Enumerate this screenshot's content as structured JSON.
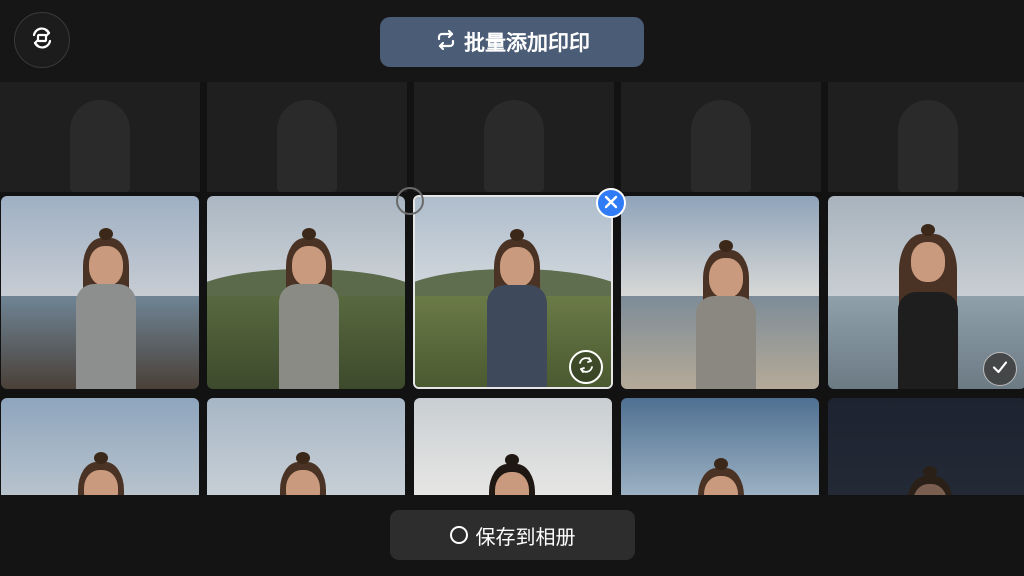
{
  "header": {
    "rotate_icon": "rotate-camera-icon",
    "batch_button_label": "批量添加印印",
    "batch_icon": "repeat-icon"
  },
  "gallery": {
    "selected_index": 2,
    "checked_index": 4,
    "rows": [
      [
        {
          "scene": "beach-sunset"
        },
        {
          "scene": "grassy-hills"
        },
        {
          "scene": "grassy-hills-selected"
        },
        {
          "scene": "beach-cloudy"
        },
        {
          "scene": "seaside-portrait"
        }
      ],
      [
        {
          "scene": "sky"
        },
        {
          "scene": "sky"
        },
        {
          "scene": "clouds"
        },
        {
          "scene": "blue-sky"
        },
        {
          "scene": "dark"
        }
      ]
    ]
  },
  "badges": {
    "close_icon": "close-icon",
    "rotate_icon": "rotate-camera-icon",
    "check_icon": "check-icon"
  },
  "footer": {
    "save_button_label": "保存到相册",
    "save_icon": "circle-icon"
  },
  "colors": {
    "accent_blue": "#2f7cf6",
    "batch_button_bg": "#4a5c76",
    "background": "#121212"
  }
}
